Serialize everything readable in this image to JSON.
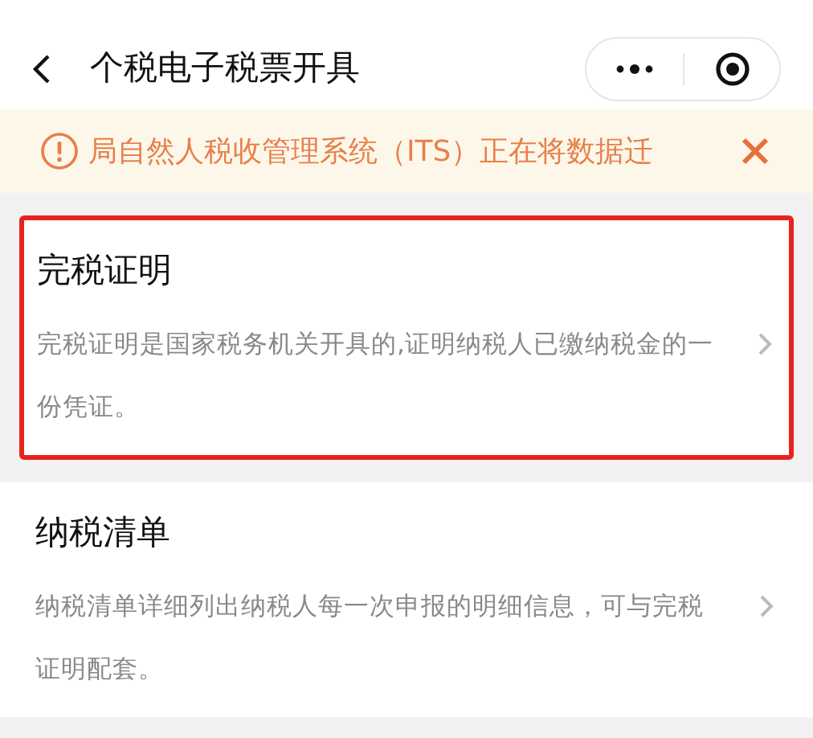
{
  "header": {
    "title": "个税电子税票开具"
  },
  "notice": {
    "text": "局自然人税收管理系统（ITS）正在将数据迁"
  },
  "items": [
    {
      "title": "完税证明",
      "description": "完税证明是国家税务机关开具的,证明纳税人已缴纳税金的一份凭证。",
      "selected": true
    },
    {
      "title": "纳税清单",
      "description": "纳税清单详细列出纳税人每一次申报的明细信息，可与完税证明配套。",
      "selected": false
    }
  ]
}
